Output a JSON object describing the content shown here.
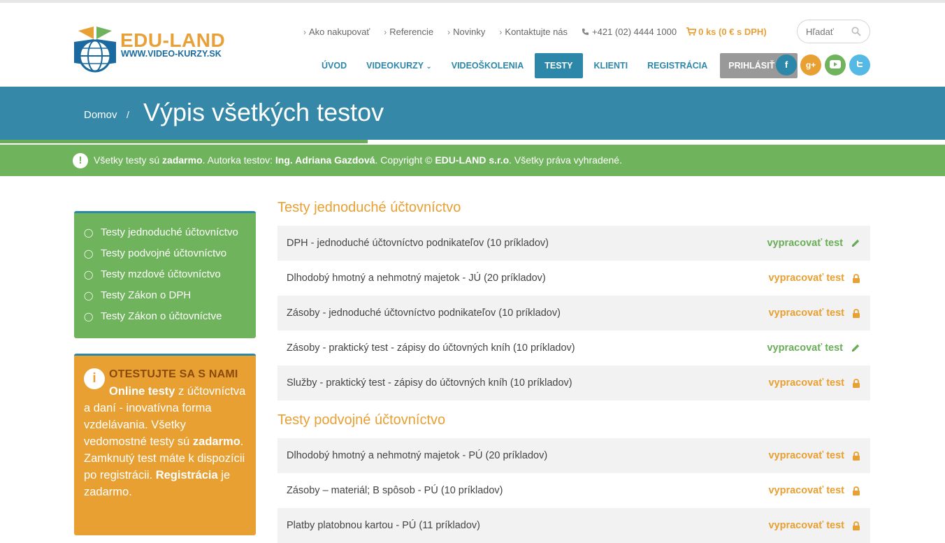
{
  "logo": {
    "brand": "EDU-LAND",
    "url": "WWW.VIDEO-KURZY.SK"
  },
  "toplinks": [
    "Ako nakupovať",
    "Referencie",
    "Novinky",
    "Kontaktujte nás"
  ],
  "phone": "+421 (02) 4444 1000",
  "cart": "0 ks (0 € s DPH)",
  "search": {
    "placeholder": "Hľadať"
  },
  "nav": [
    "ÚVOD",
    "VIDEOKURZY",
    "VIDEOŠKOLENIA",
    "TESTY",
    "KLIENTI",
    "REGISTRÁCIA",
    "PRIHLÁSIŤ SA"
  ],
  "social": [
    "f",
    "g+",
    "youtube",
    "twitter"
  ],
  "breadcrumb": {
    "home": "Domov",
    "separator": "/",
    "title": "Výpis všetkých testov"
  },
  "notice": {
    "t1": "Všetky testy sú ",
    "b1": "zadarmo",
    "t2": ". Autorka testov: ",
    "b2": "Ing. Adriana Gazdová",
    "t3": ". Copyright © ",
    "b3": "EDU-LAND s.r.o",
    "t4": ". Všetky práva vyhradené."
  },
  "sidebar": [
    "Testy jednoduché účtovníctvo",
    "Testy podvojné účtovníctvo",
    "Testy mzdové účtovníctvo",
    "Testy Zákon o DPH",
    "Testy Zákon o účtovníctve"
  ],
  "promo": {
    "heading": "OTESTUJTE SA S NAMI",
    "b1": "Online testy",
    "t1": " z účtovníctva a daní - inovatívna forma vzdelávania. Všetky vedomostné testy sú ",
    "b2": "zadarmo",
    "t2": ". Zamknutý test máte k dispozícii po registrácii. ",
    "b3": "Registrácia",
    "t3": " je zadarmo."
  },
  "sections": [
    {
      "title": "Testy jednoduché účtovníctvo",
      "tests": [
        {
          "name": "DPH - jednoduché účtovníctvo podnikateľov (10 príkladov)",
          "action": "vypracovať test",
          "status": "open"
        },
        {
          "name": "Dlhodobý hmotný a nehmotný majetok - JÚ (20 príkladov)",
          "action": "vypracovať test",
          "status": "locked"
        },
        {
          "name": "Zásoby - jednoduché účtovníctvo podnikateľov (10 príkladov)",
          "action": "vypracovať test",
          "status": "locked"
        },
        {
          "name": "Zásoby - praktický test - zápisy do účtovných kníh (10 príkladov)",
          "action": "vypracovať test",
          "status": "open"
        },
        {
          "name": "Služby - praktický test - zápisy do účtovných kníh (10 príkladov)",
          "action": "vypracovať test",
          "status": "locked"
        }
      ]
    },
    {
      "title": "Testy podvojné účtovníctvo",
      "tests": [
        {
          "name": "Dlhodobý hmotný a nehmotný majetok - PÚ (20 príkladov)",
          "action": "vypracovať test",
          "status": "locked"
        },
        {
          "name": "Zásoby – materiál; B spôsob - PÚ (10 príkladov)",
          "action": "vypracovať test",
          "status": "locked"
        },
        {
          "name": "Platby platobnou kartou - PÚ (11 príkladov)",
          "action": "vypracovať test",
          "status": "locked"
        }
      ]
    }
  ],
  "colors": {
    "blue": "#3588a8",
    "green": "#6fb35c",
    "orange": "#e8a033",
    "gray": "#999999"
  }
}
